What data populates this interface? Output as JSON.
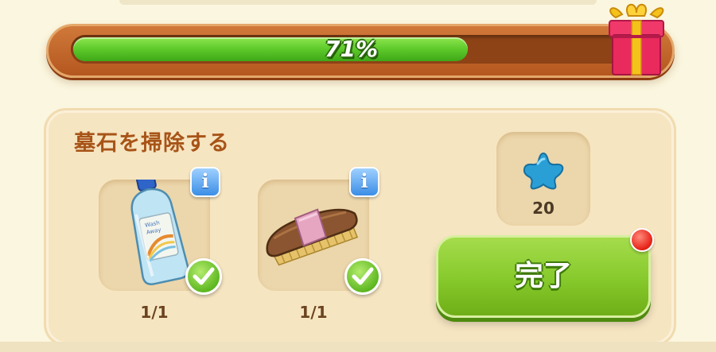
{
  "progress": {
    "percent": 71,
    "label": "71%"
  },
  "task": {
    "title": "墓石を掃除する",
    "items": [
      {
        "icon": "detergent-bottle-icon",
        "count": "1/1",
        "info": "i",
        "completed": true
      },
      {
        "icon": "scrub-brush-icon",
        "count": "1/1",
        "info": "i",
        "completed": true
      }
    ],
    "reward": {
      "icon": "blue-star-icon",
      "amount": "20"
    },
    "done_button": {
      "label": "完了",
      "has_notification": true
    }
  },
  "colors": {
    "progress_fill": "#5cc92a",
    "frame": "#c2662a",
    "title": "#a85418",
    "done_button": "#86c92b",
    "notification": "#e8261c",
    "info_button": "#3b8ee6"
  }
}
